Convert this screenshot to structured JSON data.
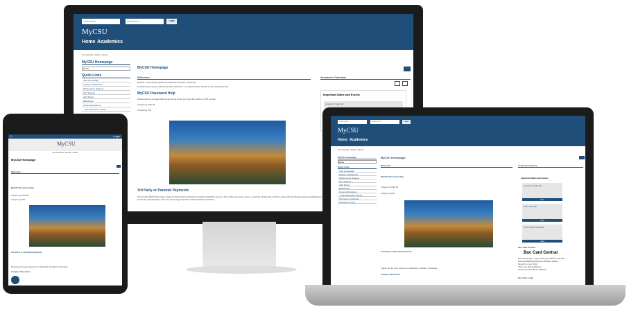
{
  "desktop": {
    "login": {
      "user_placeholder": "Username",
      "pass_placeholder": "Password",
      "button": "Login"
    },
    "logo": "MyCSU",
    "nav": [
      "Home",
      "Academics"
    ],
    "breadcrumb": "You are here: Home › Home",
    "sidebar_title": "MyCSU Homepage",
    "select_value": "Home",
    "quick_links_title": "Quick Links",
    "quick_links": [
      "CSU Homepage",
      "Faculty / Staff Email",
      "Maintenance Request",
      "24/7 Support",
      "A&P Portal",
      "Blackboard",
      "Campus Bookstore",
      "– Marshall Rivers Library"
    ],
    "page_title": "MyCSU Homepage",
    "welcome": "Welcome !",
    "welcome_text": "MyCSU is the student portal for Charleston Southern University.",
    "search_text": "To Search the courses offered by CSU, click here, ( or select Course Search on the Academics tab.",
    "password_help": "MyCSU Password Help",
    "password_text": "Please use the provided links if you do not know your CSU ID number or PIN number.",
    "forgot_id": "I forgot my CSU ID",
    "forgot_pin": "I forgot my PIN",
    "third_party": "3rd Party or Parental Payments",
    "third_party_text": "The student MUST first create a login for their parents through the student's MyCSU account. The student can log in above, select the student tab, and then select the My Student Account dashboard to create the parental login. Once the parent login has been created, Please click here.",
    "academic_calendar": "Academic Calendar",
    "dates_title": "Important Dates and Events",
    "academic_calendar_link": "Academic Calendar"
  },
  "tablet": {
    "menu_label": "≡",
    "login": "Login",
    "logo": "MyCSU",
    "breadcrumb": "You are here: Home › Home",
    "page_title": "MyCSU Homepage",
    "welcome": "Welcome !",
    "password_help": "MyCSU Password Help",
    "forgot_id": "I forgot my CSU ID",
    "forgot_pin": "I forgot my PIN",
    "third_party": "3rd Party or Parental Payments",
    "thanks": "Thank you for your interest in Charleston Southern University.",
    "campus_resources": "Campus Resources"
  },
  "laptop": {
    "login": {
      "user_placeholder": "Username",
      "pass_placeholder": "Password",
      "button": "Login"
    },
    "logo": "MyCSU",
    "nav": [
      "Home",
      "Academics"
    ],
    "breadcrumb": "You are here: Home › Home",
    "sidebar_title": "MyCSU Homepage",
    "select_value": "Home",
    "quick_links_title": "Quick Links",
    "quick_links": [
      "CSU Homepage",
      "Faculty / Staff Email",
      "Maintenance Request",
      "24/7 Support",
      "A&P Portal",
      "Blackboard",
      "Campus Bookstore",
      "– Marshall Rivers Library",
      "The Source Calendar",
      "Employee Survey"
    ],
    "page_title": "MyCSU Homepage",
    "welcome": "Welcome !",
    "password_help": "MyCSU Password Help",
    "forgot_id": "I forgot my CSU ID",
    "forgot_pin": "I forgot my PIN",
    "third_party": "3rd Party or Parental Payments",
    "thanks": "Thank you for your interest in Charleston Southern University.",
    "campus_resources": "Campus Resources",
    "academic_calendar": "Academic Calendar",
    "dates_title": "Important Dates and Events",
    "cards": [
      {
        "label": "Academic Calendar",
        "btn": "Visit"
      },
      {
        "label": "CSU Calendar",
        "btn": "Visit"
      },
      {
        "label": "CSU Sports Schedule",
        "btn": "Visit"
      }
    ],
    "buc_card": "Buc Card Central",
    "buc_card_title": "Buc Card Central",
    "buc_lines": [
      "Buc Card Login - Log in with your Web ID and PIN.",
      "Personal Banking Services (Parking Spots)",
      "Deposit to your Card",
      "View your Dining Balance",
      "Order your Buc Bucks Balance"
    ],
    "buc_alert": "Buc Alert Login"
  }
}
